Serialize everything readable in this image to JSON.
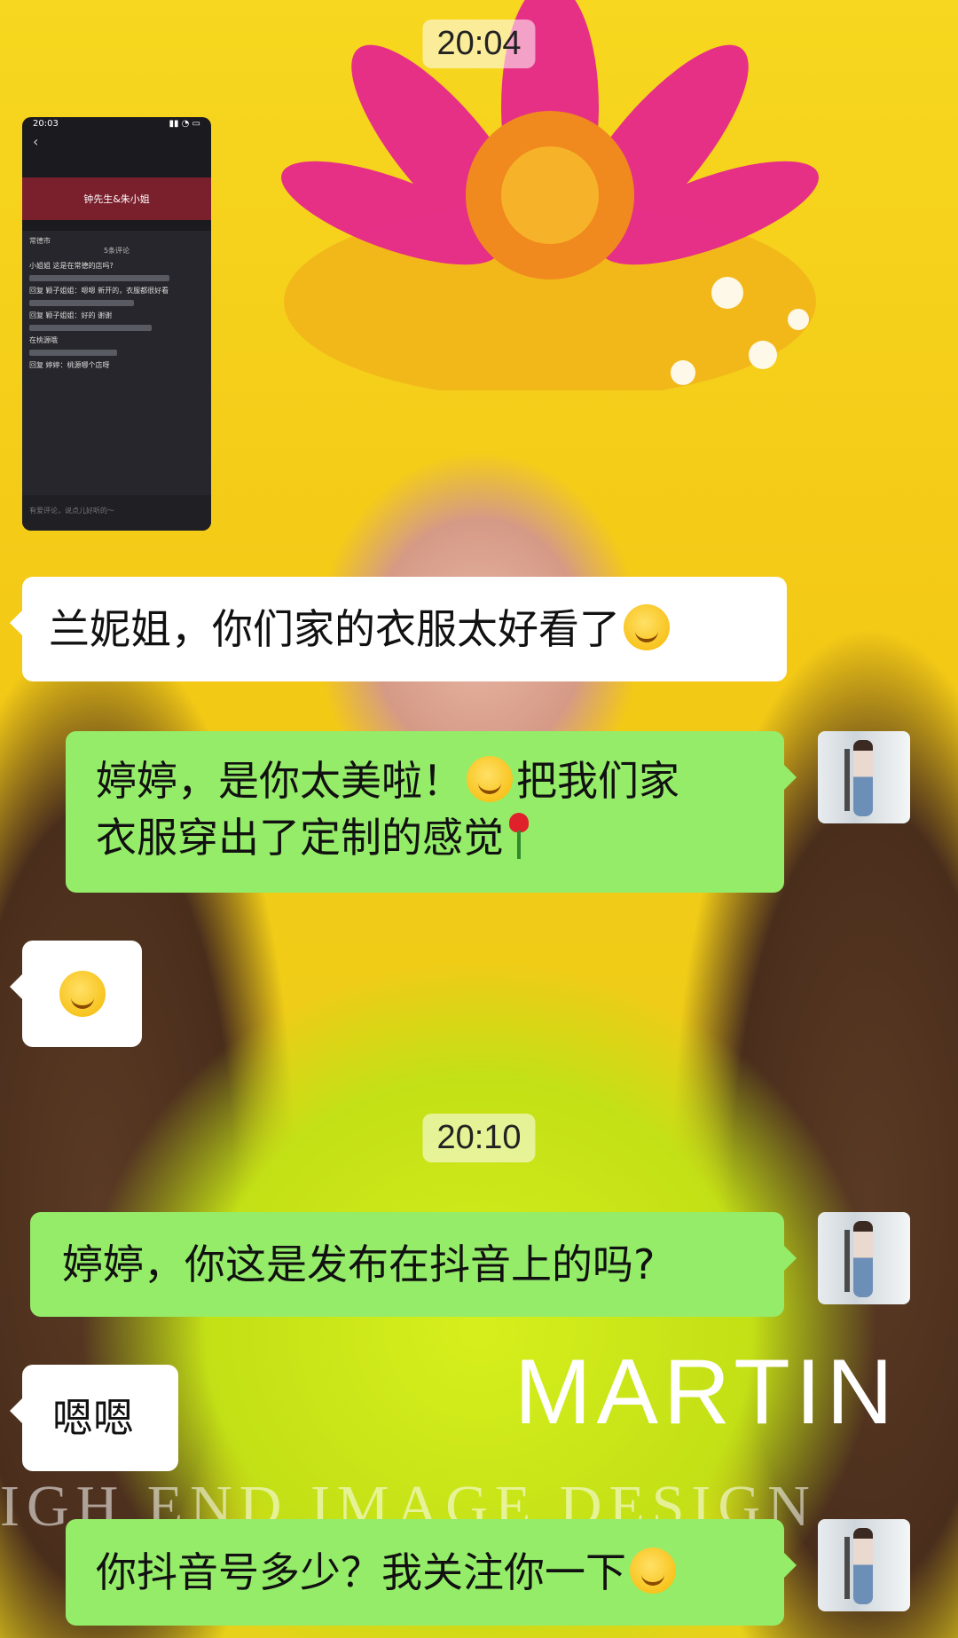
{
  "chat": {
    "timestamps": [
      "20:04",
      "20:10"
    ],
    "messages": [
      {
        "side": "in",
        "kind": "image",
        "text": ""
      },
      {
        "side": "in",
        "kind": "text",
        "text": "兰妮姐，你们家的衣服太好看了"
      },
      {
        "side": "out",
        "kind": "text",
        "line1": "婷婷，是你太美啦！",
        "line1b": "把我们家",
        "line2": "衣服穿出了定制的感觉"
      },
      {
        "side": "in",
        "kind": "emoji",
        "text": "😂"
      },
      {
        "side": "out",
        "kind": "text",
        "text": "婷婷，你这是发布在抖音上的吗?"
      },
      {
        "side": "in",
        "kind": "text",
        "text": "嗯嗯"
      },
      {
        "side": "out",
        "kind": "text",
        "text": "你抖音号多少？我关注你一下"
      }
    ]
  },
  "screenshot": {
    "status_time": "20:03",
    "band_title": "钟先生&朱小姐",
    "location": "常德市",
    "comment_count": "5条评论",
    "comments": [
      "小姐姐 这是在常德的店吗?",
      "回复 颖子姐姐：嗯嗯 新开的，衣服都很好看",
      "回复 颖子姐姐：好的 谢谢",
      "在桃源哦",
      "回复 婷婷：桃源哪个店呀"
    ],
    "input_placeholder": "有爱评论，说点儿好听的～"
  },
  "background": {
    "brand_text": "MARTIN",
    "brand_sub": "IGH END IMAGE DESIGN"
  },
  "colors": {
    "out_bubble": "#95ec69",
    "in_bubble": "#ffffff",
    "accent_band": "#7a1f2c"
  }
}
